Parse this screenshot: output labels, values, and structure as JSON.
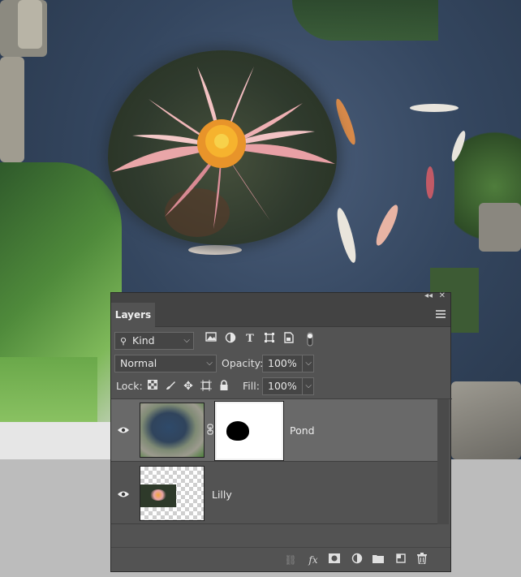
{
  "panel": {
    "tab_label": "Layers",
    "filter": {
      "kind_label": "Kind",
      "icons": [
        "image-filter-icon",
        "adjustment-filter-icon",
        "type-filter-icon",
        "shape-filter-icon",
        "smart-object-filter-icon",
        "filter-toggle-icon"
      ]
    },
    "blend_mode": "Normal",
    "opacity_label": "Opacity:",
    "opacity_value": "100%",
    "lock_label": "Lock:",
    "lock_icons": [
      "lock-transparent-pixels-icon",
      "lock-image-pixels-icon",
      "lock-position-icon",
      "lock-artboard-icon",
      "lock-all-icon"
    ],
    "fill_label": "Fill:",
    "fill_value": "100%",
    "layers": [
      {
        "name": "Pond",
        "visible": true,
        "selected": true,
        "has_mask": true
      },
      {
        "name": "Lilly",
        "visible": true,
        "selected": false,
        "has_mask": false
      }
    ],
    "bottom_icons": [
      "link-layers-icon",
      "layer-style-icon",
      "add-mask-icon",
      "adjustment-layer-icon",
      "new-group-icon",
      "new-layer-icon",
      "delete-layer-icon"
    ],
    "fx_label": "fx"
  },
  "colors": {
    "panel_bg": "#535353",
    "selected_layer": "#696969",
    "canvas_water": "#34465f"
  }
}
